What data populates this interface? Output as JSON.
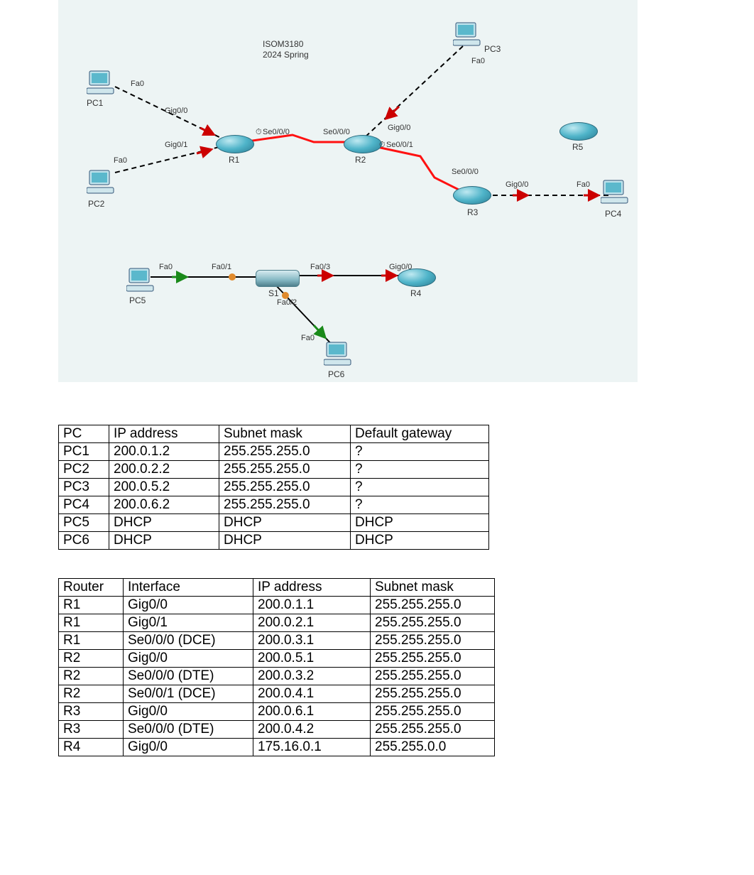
{
  "diagram": {
    "title_line1": "ISOM3180",
    "title_line2": "2024 Spring",
    "nodes": {
      "PC1": {
        "label": "PC1",
        "port": "Fa0"
      },
      "PC2": {
        "label": "PC2",
        "port": "Fa0"
      },
      "PC3": {
        "label": "PC3",
        "port": "Fa0"
      },
      "PC4": {
        "label": "PC4",
        "port": "Fa0"
      },
      "PC5": {
        "label": "PC5",
        "port": "Fa0"
      },
      "PC6": {
        "label": "PC6",
        "port": "Fa0"
      },
      "R1": {
        "label": "R1"
      },
      "R2": {
        "label": "R2"
      },
      "R3": {
        "label": "R3"
      },
      "R4": {
        "label": "R4"
      },
      "R5": {
        "label": "R5"
      },
      "S1": {
        "label": "S1"
      }
    },
    "ports": {
      "R1_g00": "Gig0/0",
      "R1_g01": "Gig0/1",
      "R1_s000": "Se0/0/0",
      "R2_g00": "Gig0/0",
      "R2_s000": "Se0/0/0",
      "R2_s001": "Se0/0/1",
      "R3_g00": "Gig0/0",
      "R3_s000": "Se0/0/0",
      "R4_g00": "Gig0/0",
      "S1_f01": "Fa0/1",
      "S1_f02": "Fa0/2",
      "S1_f03": "Fa0/3",
      "clock": "⏱"
    }
  },
  "pc_table": {
    "headers": [
      "PC",
      "IP address",
      "Subnet mask",
      "Default gateway"
    ],
    "rows": [
      [
        "PC1",
        "200.0.1.2",
        "255.255.255.0",
        "?"
      ],
      [
        "PC2",
        "200.0.2.2",
        "255.255.255.0",
        "?"
      ],
      [
        "PC3",
        "200.0.5.2",
        "255.255.255.0",
        "?"
      ],
      [
        "PC4",
        "200.0.6.2",
        "255.255.255.0",
        "?"
      ],
      [
        "PC5",
        "DHCP",
        "DHCP",
        "DHCP"
      ],
      [
        "PC6",
        "DHCP",
        "DHCP",
        "DHCP"
      ]
    ]
  },
  "router_table": {
    "headers": [
      "Router",
      "Interface",
      "IP address",
      "Subnet mask"
    ],
    "rows": [
      [
        "R1",
        "Gig0/0",
        "200.0.1.1",
        "255.255.255.0"
      ],
      [
        "R1",
        "Gig0/1",
        "200.0.2.1",
        "255.255.255.0"
      ],
      [
        "R1",
        "Se0/0/0 (DCE)",
        "200.0.3.1",
        "255.255.255.0"
      ],
      [
        "R2",
        "Gig0/0",
        "200.0.5.1",
        "255.255.255.0"
      ],
      [
        "R2",
        "Se0/0/0 (DTE)",
        "200.0.3.2",
        "255.255.255.0"
      ],
      [
        "R2",
        "Se0/0/1 (DCE)",
        "200.0.4.1",
        "255.255.255.0"
      ],
      [
        "R3",
        "Gig0/0",
        "200.0.6.1",
        "255.255.255.0"
      ],
      [
        "R3",
        "Se0/0/0 (DTE)",
        "200.0.4.2",
        "255.255.255.0"
      ],
      [
        "R4",
        "Gig0/0",
        "175.16.0.1",
        "255.255.0.0"
      ]
    ]
  }
}
